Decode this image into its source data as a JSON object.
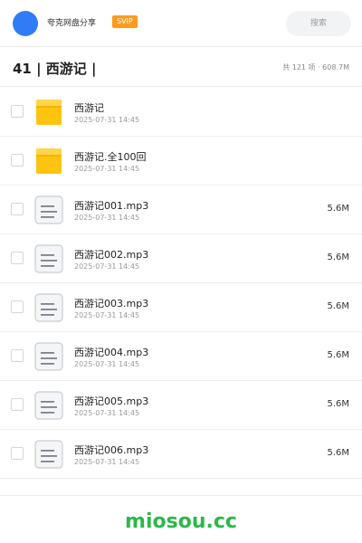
{
  "header": {
    "user_name": "夸克网盘分享",
    "badge": "SVIP",
    "search_placeholder": "搜索"
  },
  "titlebar": {
    "title": "41 | 西游记 |",
    "summary": "共 121 项 · 608.7M"
  },
  "files": [
    {
      "name": "西游记",
      "date": "2025-07-31 14:45",
      "size": "",
      "type": "folder"
    },
    {
      "name": "西游记.全100回",
      "date": "2025-07-31 14:45",
      "size": "",
      "type": "folder"
    },
    {
      "name": "西游记001.mp3",
      "date": "2025-07-31 14:45",
      "size": "5.6M",
      "type": "file"
    },
    {
      "name": "西游记002.mp3",
      "date": "2025-07-31 14:45",
      "size": "5.6M",
      "type": "file"
    },
    {
      "name": "西游记003.mp3",
      "date": "2025-07-31 14:45",
      "size": "5.6M",
      "type": "file"
    },
    {
      "name": "西游记004.mp3",
      "date": "2025-07-31 14:45",
      "size": "5.6M",
      "type": "file"
    },
    {
      "name": "西游记005.mp3",
      "date": "2025-07-31 14:45",
      "size": "5.6M",
      "type": "file"
    },
    {
      "name": "西游记006.mp3",
      "date": "2025-07-31 14:45",
      "size": "5.6M",
      "type": "file"
    }
  ],
  "footer": {
    "brand": "miosou.cc"
  },
  "colors": {
    "avatar": "#2f7cf6",
    "badge": "#ff9a1f",
    "folder": "#ffc410",
    "brand": "#2db84a"
  }
}
